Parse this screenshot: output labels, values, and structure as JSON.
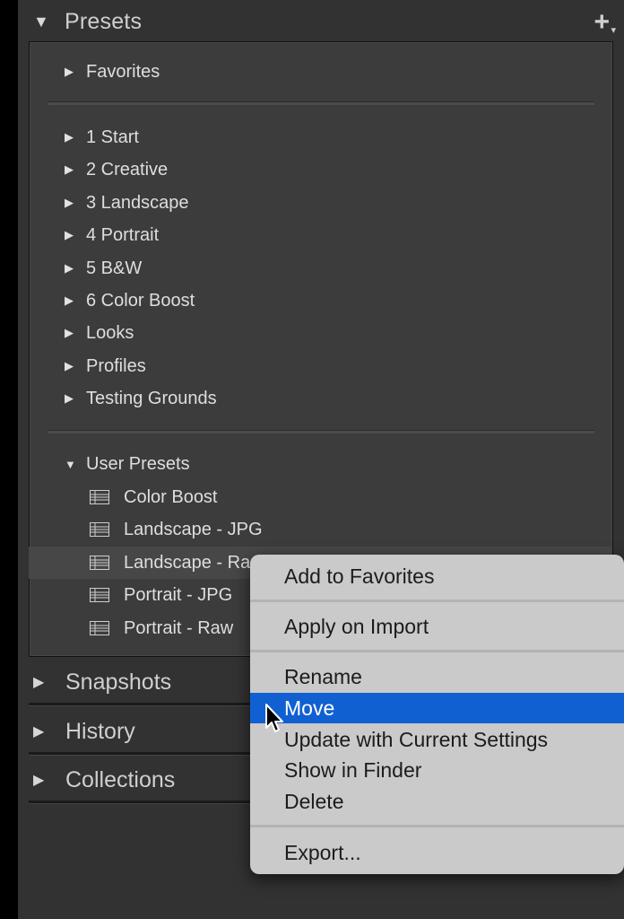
{
  "presets_panel": {
    "title": "Presets",
    "add_button": "+",
    "favorites": "Favorites",
    "folders": [
      "1 Start",
      "2 Creative",
      "3 Landscape",
      "4 Portrait",
      "5 B&W",
      "6 Color Boost",
      "Looks",
      "Profiles",
      "Testing Grounds"
    ],
    "user_presets": {
      "label": "User Presets",
      "items": [
        "Color Boost",
        "Landscape - JPG",
        "Landscape - Ra",
        "Portrait - JPG",
        "Portrait - Raw"
      ],
      "selected_index": 2
    }
  },
  "sections": [
    "Snapshots",
    "History",
    "Collections"
  ],
  "context_menu": {
    "add_to_favorites": "Add to Favorites",
    "apply_on_import": "Apply on Import",
    "rename": "Rename",
    "move": "Move",
    "update": "Update with Current Settings",
    "show_in_finder": "Show in Finder",
    "delete": "Delete",
    "export": "Export...",
    "highlighted": "Move"
  },
  "colors": {
    "panel_bg": "#323232",
    "box_bg": "#3c3c3c",
    "menu_bg": "#cacaca",
    "highlight": "#1160d2"
  },
  "icons": {
    "collapse": "triangle-down-icon",
    "expand": "triangle-right-icon",
    "preset": "preset-list-icon",
    "cursor": "arrow-cursor-icon"
  }
}
